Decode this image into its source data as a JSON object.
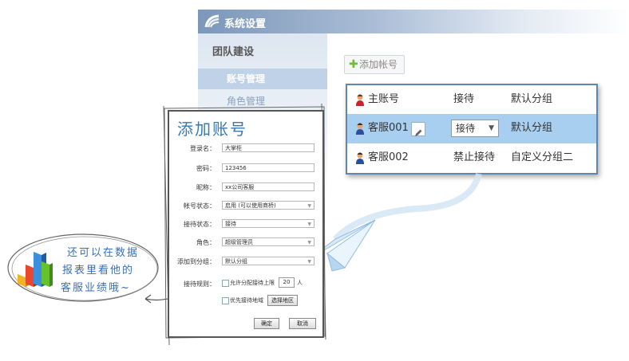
{
  "window": {
    "title": "系统设置",
    "sidebar": {
      "section": "团队建设",
      "items": [
        {
          "label": "账号管理",
          "active": true
        },
        {
          "label": "角色管理",
          "active": false
        }
      ]
    },
    "add_button": "添加帐号",
    "accounts": [
      {
        "name": "主账号",
        "status": "接待",
        "group": "默认分组"
      },
      {
        "name": "客服001",
        "status": "接待",
        "group": "默认分组"
      },
      {
        "name": "客服002",
        "status": "禁止接待",
        "group": "自定义分组二"
      }
    ],
    "colors": {
      "accent": "#5f87ad",
      "selected_row": "#a8cff0",
      "titlebar": "#7c97b9"
    }
  },
  "dialog": {
    "title": "添加账号",
    "fields": [
      {
        "label": "登录名：",
        "value": "大掌柜"
      },
      {
        "label": "密码：",
        "value": "123456"
      },
      {
        "label": "昵称：",
        "value": "xx公司客服"
      },
      {
        "label": "帐号状态：",
        "value": "启用 (可以使用商桥)"
      },
      {
        "label": "接待状态：",
        "value": "接待"
      },
      {
        "label": "角色：",
        "value": "超级管理员"
      },
      {
        "label": "添加到分组：",
        "value": "默认分组"
      }
    ],
    "rule_label": "接待规则：",
    "rule_limit_text": "允许分配接待上限",
    "rule_limit_value": "20",
    "rule_unit": "人",
    "region_text": "优先接待地域",
    "region_button": "选择地区",
    "ok_button": "确定",
    "cancel_button": "取消"
  },
  "bubble": {
    "lines": [
      "还可以在数据",
      "报表里看他的",
      "客服业绩哦~"
    ]
  }
}
